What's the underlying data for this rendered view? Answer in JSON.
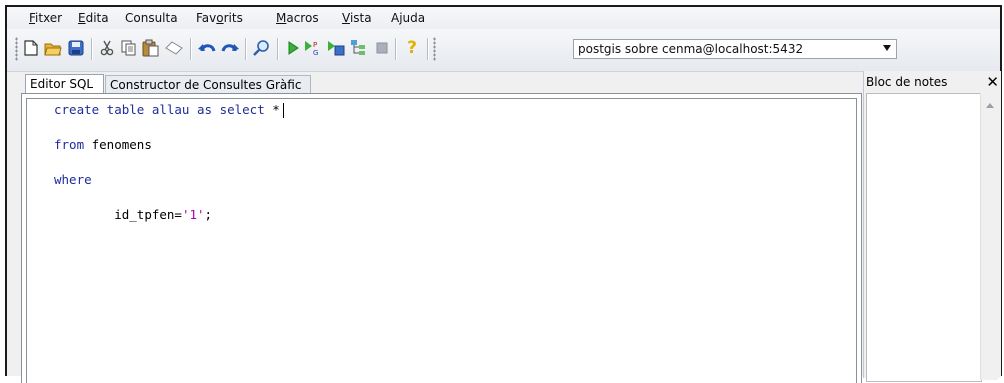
{
  "menu": [
    {
      "pre": "",
      "ul": "F",
      "post": "itxer"
    },
    {
      "pre": "",
      "ul": "E",
      "post": "dita"
    },
    {
      "pre": "Consulta",
      "ul": "",
      "post": ""
    },
    {
      "pre": "Fav",
      "ul": "o",
      "post": "rits"
    },
    {
      "pre": "",
      "ul": "M",
      "post": "acros"
    },
    {
      "pre": "",
      "ul": "V",
      "post": "ista"
    },
    {
      "pre": "Ajuda",
      "ul": "",
      "post": ""
    }
  ],
  "toolbar": {
    "icons": [
      "new-file-icon",
      "open-folder-icon",
      "save-icon",
      "cut-icon",
      "copy-icon",
      "paste-icon",
      "eraser-icon",
      "undo-icon",
      "redo-icon",
      "find-icon",
      "run-icon",
      "explain-icon",
      "execute-pgscript-icon",
      "explain-query-icon",
      "stop-icon",
      "help-icon"
    ],
    "connection_value": "postgis sobre cenma@localhost:5432"
  },
  "tabs": [
    {
      "label": "Editor SQL",
      "active": true
    },
    {
      "label": "Constructor de Consultes Gràfic",
      "active": false
    }
  ],
  "editor": {
    "lines": [
      {
        "kw": "create table allau as select",
        "rest": " *"
      },
      {
        "kw": "from",
        "rest": " fenomens"
      },
      {
        "kw": "where",
        "rest": ""
      },
      {
        "indent": "        ",
        "kw": "",
        "rest": "id_tpfen=",
        "str": "'1'",
        "tail": ";"
      }
    ]
  },
  "notes": {
    "title": "Bloc de notes",
    "close": "✕"
  }
}
